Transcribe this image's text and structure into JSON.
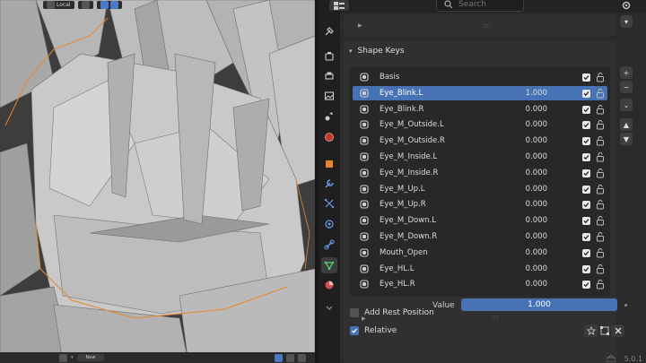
{
  "viewport": {
    "orientation_label": "Local",
    "new_label": "New"
  },
  "properties": {
    "search_placeholder": "Search",
    "shape_keys": {
      "title": "Shape Keys",
      "items": [
        {
          "name": "Basis",
          "value": "",
          "selected": false
        },
        {
          "name": "Eye_Blink.L",
          "value": "1.000",
          "selected": true
        },
        {
          "name": "Eye_Blink.R",
          "value": "0.000",
          "selected": false
        },
        {
          "name": "Eye_M_Outside.L",
          "value": "0.000",
          "selected": false
        },
        {
          "name": "Eye_M_Outside.R",
          "value": "0.000",
          "selected": false
        },
        {
          "name": "Eye_M_Inside.L",
          "value": "0.000",
          "selected": false
        },
        {
          "name": "Eye_M_Inside.R",
          "value": "0.000",
          "selected": false
        },
        {
          "name": "Eye_M_Up.L",
          "value": "0.000",
          "selected": false
        },
        {
          "name": "Eye_M_Up.R",
          "value": "0.000",
          "selected": false
        },
        {
          "name": "Eye_M_Down.L",
          "value": "0.000",
          "selected": false
        },
        {
          "name": "Eye_M_Down.R",
          "value": "0.000",
          "selected": false
        },
        {
          "name": "Mouth_Open",
          "value": "0.000",
          "selected": false
        },
        {
          "name": "Eye_HL.L",
          "value": "0.000",
          "selected": false
        },
        {
          "name": "Eye_HL.R",
          "value": "0.000",
          "selected": false
        }
      ],
      "add_rest_position_label": "Add Rest Position",
      "add_rest_position_checked": false,
      "relative_label": "Relative",
      "relative_checked": true,
      "value_label": "Value",
      "value": "1.000"
    }
  },
  "status": {
    "version": "5.0.1"
  },
  "colors": {
    "accent": "#4772b3",
    "panel": "#303030",
    "viewport_bg": "#3d3d3d",
    "selection_outline": "#e8872a"
  }
}
